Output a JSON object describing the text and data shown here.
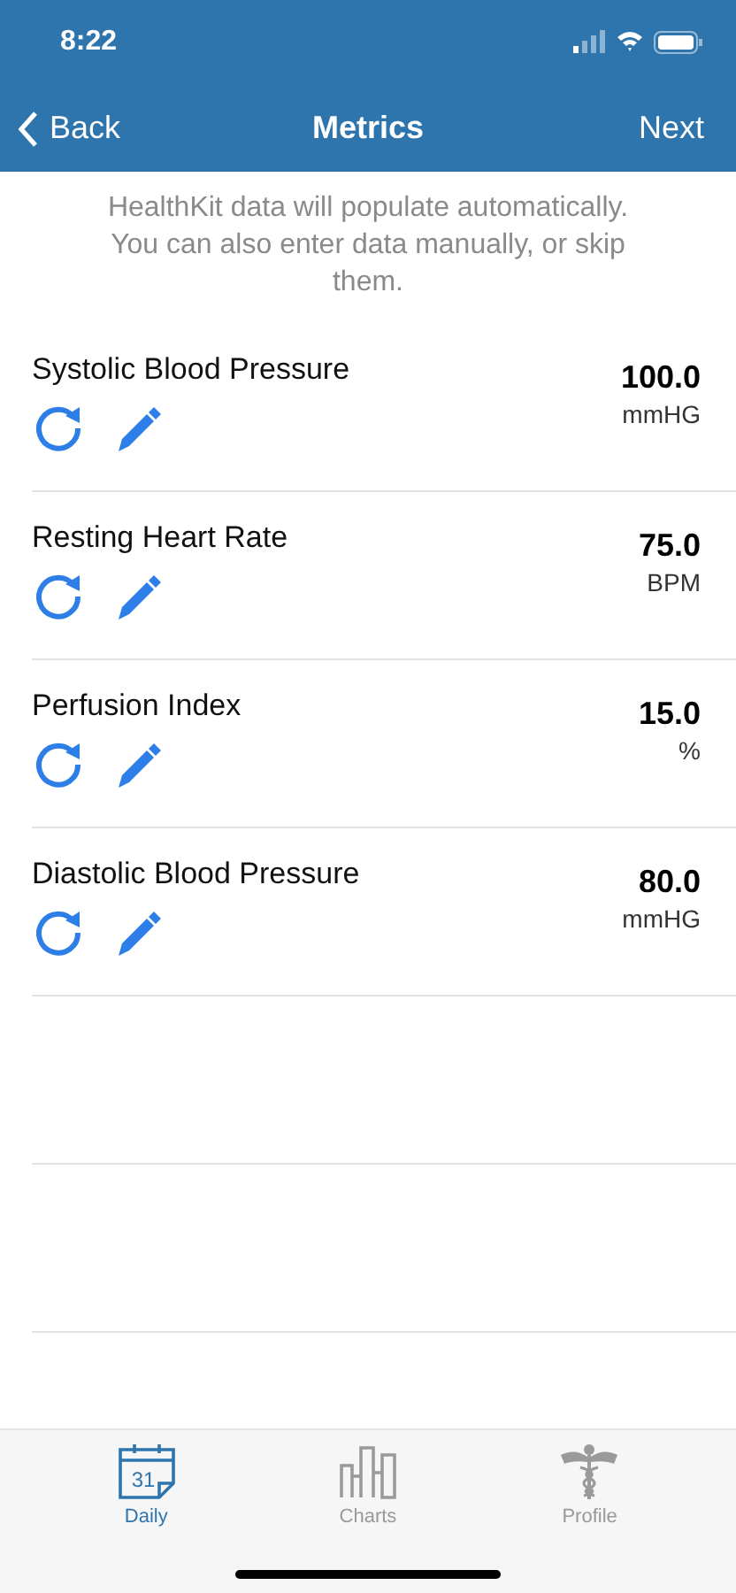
{
  "status_bar": {
    "time": "8:22"
  },
  "nav": {
    "back": "Back",
    "title": "Metrics",
    "next": "Next"
  },
  "intro": "HealthKit data will populate automatically. You can also enter data manually, or skip them.",
  "metrics": [
    {
      "name": "Systolic Blood Pressure",
      "value": "100.0",
      "unit": "mmHG"
    },
    {
      "name": "Resting Heart Rate",
      "value": "75.0",
      "unit": "BPM"
    },
    {
      "name": "Perfusion Index",
      "value": "15.0",
      "unit": "%"
    },
    {
      "name": "Diastolic Blood Pressure",
      "value": "80.0",
      "unit": "mmHG"
    }
  ],
  "tabs": [
    {
      "kind": "calendar",
      "label": "Daily",
      "icon_text": "31",
      "selected": true
    },
    {
      "kind": "chart",
      "label": "Charts",
      "selected": false
    },
    {
      "kind": "caduceus",
      "label": "Profile",
      "selected": false
    }
  ]
}
